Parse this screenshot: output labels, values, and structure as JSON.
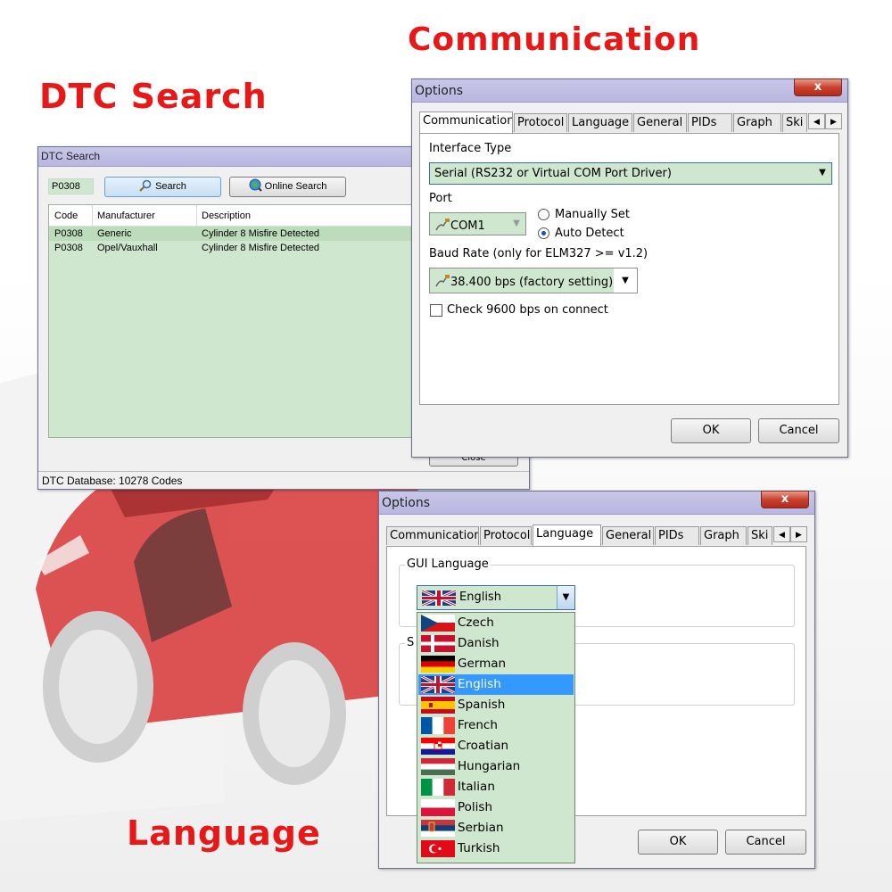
{
  "labels": {
    "communication": "Communication",
    "dtc_search": "DTC Search",
    "language": "Language"
  },
  "dtc_window": {
    "title": "DTC Search",
    "code_input_value": "P0308",
    "search_button": "Search",
    "online_search_button": "Online Search",
    "columns": [
      "Code",
      "Manufacturer",
      "Description"
    ],
    "rows": [
      {
        "code": "P0308",
        "manufacturer": "Generic",
        "description": "Cylinder 8 Misfire Detected"
      },
      {
        "code": "P0308",
        "manufacturer": "Opel/Vauxhall",
        "description": "Cylinder 8 Misfire Detected"
      }
    ],
    "close_button": "Close",
    "status": "DTC Database: 10278 Codes"
  },
  "options_comm": {
    "title": "Options",
    "close_glyph": "x",
    "tabs": [
      "Communication",
      "Protocol",
      "Language",
      "General",
      "PIDs",
      "Graph",
      "Ski"
    ],
    "active_tab": "Communication",
    "interface_type_label": "Interface Type",
    "interface_type_value": "Serial (RS232 or Virtual COM Port Driver)",
    "port_label": "Port",
    "port_value": "COM1",
    "manually_set_label": "Manually Set",
    "auto_detect_label": "Auto Detect",
    "auto_detect_selected": true,
    "baud_label": "Baud Rate (only for ELM327 >= v1.2)",
    "baud_value": "38.400 bps (factory setting)",
    "check_9600_label": "Check 9600 bps on connect",
    "check_9600_checked": false,
    "ok_button": "OK",
    "cancel_button": "Cancel"
  },
  "options_lang": {
    "title": "Options",
    "close_glyph": "x",
    "tabs": [
      "Communication",
      "Protocol",
      "Language",
      "General",
      "PIDs",
      "Graph",
      "Ski"
    ],
    "active_tab": "Language",
    "gui_language_label": "GUI Language",
    "selected_language": "English",
    "second_group_label_visible": "S",
    "languages": [
      "Czech",
      "Danish",
      "German",
      "English",
      "Spanish",
      "French",
      "Croatian",
      "Hungarian",
      "Italian",
      "Polish",
      "Serbian",
      "Turkish"
    ],
    "highlighted_language": "English",
    "ok_button": "OK",
    "cancel_button": "Cancel"
  },
  "colors": {
    "label_red": "#e81818",
    "list_green": "#cfe6cf",
    "selection_blue": "#3399ff",
    "titlebar": "#c3c1e6"
  }
}
